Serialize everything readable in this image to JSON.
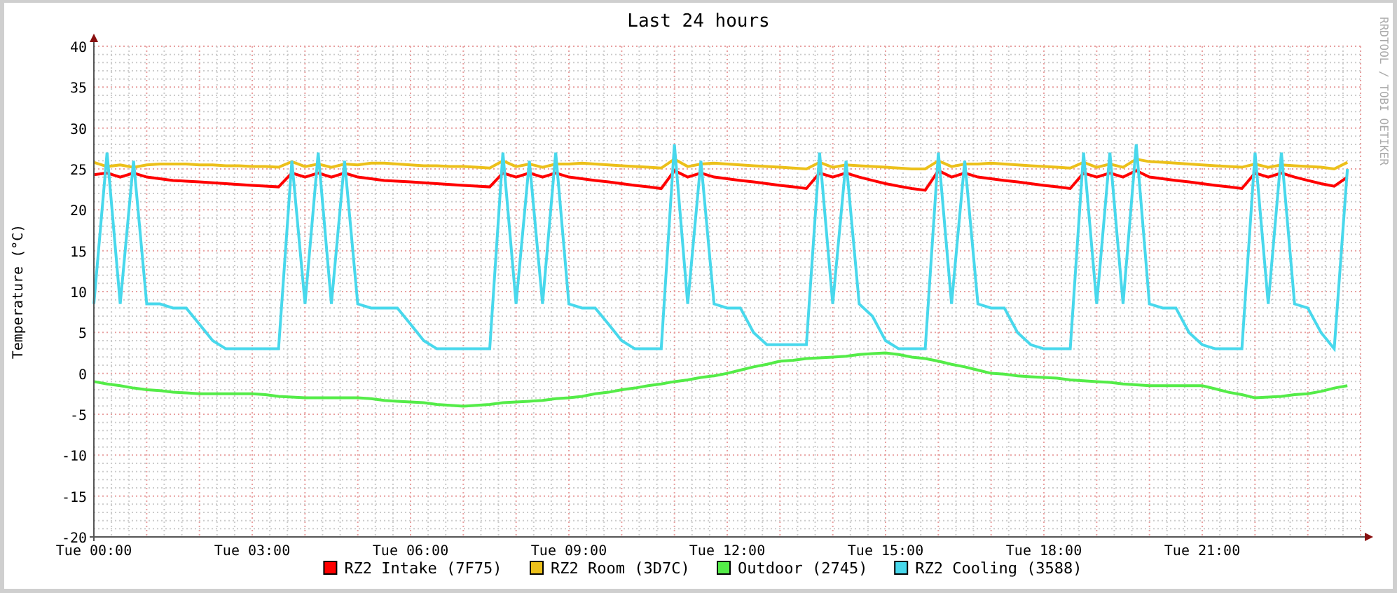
{
  "graph": {
    "side_text": "RRDTOOL / TOBI OETIKER",
    "chart_data": {
      "type": "line",
      "title": "Last 24 hours",
      "ylabel": "Temperature (°C)",
      "categories": [
        "Tue 00:00",
        null,
        null,
        null,
        null,
        null,
        null,
        null,
        null,
        null,
        null,
        null,
        "Tue 03:00",
        null,
        null,
        null,
        null,
        null,
        null,
        null,
        null,
        null,
        null,
        null,
        "Tue 06:00",
        null,
        null,
        null,
        null,
        null,
        null,
        null,
        null,
        null,
        null,
        null,
        "Tue 09:00",
        null,
        null,
        null,
        null,
        null,
        null,
        null,
        null,
        null,
        null,
        null,
        "Tue 12:00",
        null,
        null,
        null,
        null,
        null,
        null,
        null,
        null,
        null,
        null,
        null,
        "Tue 15:00",
        null,
        null,
        null,
        null,
        null,
        null,
        null,
        null,
        null,
        null,
        null,
        "Tue 18:00",
        null,
        null,
        null,
        null,
        null,
        null,
        null,
        null,
        null,
        null,
        null,
        "Tue 21:00",
        null,
        null,
        null,
        null,
        null,
        null,
        null,
        null,
        null,
        null,
        null
      ],
      "ylim": [
        -20,
        40
      ],
      "grid": true,
      "legend": "bottom",
      "yticks": [
        40,
        35,
        30,
        25,
        20,
        15,
        10,
        5,
        0,
        -5,
        -10,
        -15,
        -20
      ],
      "series": [
        {
          "name": "RZ2 Intake (7F75)",
          "color": "#ff0000",
          "values": [
            24.3,
            24.5,
            24,
            24.5,
            24,
            23.8,
            23.6,
            23.5,
            23.4,
            23.3,
            23.2,
            23.1,
            23,
            22.9,
            22.8,
            24.5,
            24,
            24.5,
            24,
            24.5,
            24,
            23.8,
            23.6,
            23.5,
            23.4,
            23.3,
            23.2,
            23.1,
            23,
            22.9,
            22.8,
            24.5,
            24,
            24.5,
            24,
            24.5,
            24,
            23.8,
            23.6,
            23.4,
            23.2,
            23,
            22.8,
            22.6,
            24.8,
            24,
            24.5,
            24,
            23.8,
            23.6,
            23.4,
            23.2,
            23,
            22.8,
            22.6,
            24.5,
            24,
            24.5,
            24,
            23.6,
            23.2,
            22.9,
            22.6,
            22.4,
            24.8,
            24,
            24.5,
            24,
            23.8,
            23.6,
            23.4,
            23.2,
            23,
            22.8,
            22.6,
            24.5,
            24,
            24.5,
            24,
            24.8,
            24,
            23.8,
            23.6,
            23.4,
            23.2,
            23,
            22.8,
            22.6,
            24.5,
            24,
            24.5,
            24,
            23.6,
            23.2,
            22.9,
            24
          ]
        },
        {
          "name": "RZ2 Room (3D7C)",
          "color": "#ecc01a",
          "values": [
            25.8,
            25.3,
            25.5,
            25.2,
            25.5,
            25.6,
            25.6,
            25.6,
            25.5,
            25.5,
            25.4,
            25.4,
            25.3,
            25.3,
            25.2,
            25.9,
            25.3,
            25.6,
            25.2,
            25.6,
            25.5,
            25.7,
            25.7,
            25.6,
            25.5,
            25.4,
            25.4,
            25.3,
            25.3,
            25.2,
            25.1,
            26,
            25.3,
            25.6,
            25.2,
            25.6,
            25.6,
            25.7,
            25.6,
            25.5,
            25.4,
            25.3,
            25.2,
            25.1,
            26.2,
            25.3,
            25.6,
            25.7,
            25.6,
            25.5,
            25.4,
            25.3,
            25.2,
            25.1,
            25,
            25.8,
            25.2,
            25.5,
            25.4,
            25.3,
            25.2,
            25.1,
            25,
            25,
            26,
            25.3,
            25.6,
            25.6,
            25.7,
            25.6,
            25.5,
            25.4,
            25.3,
            25.2,
            25.1,
            25.8,
            25.2,
            25.6,
            25.2,
            26.2,
            25.9,
            25.8,
            25.7,
            25.6,
            25.5,
            25.4,
            25.3,
            25.2,
            25.6,
            25.2,
            25.5,
            25.4,
            25.3,
            25.2,
            25,
            25.8
          ]
        },
        {
          "name": "Outdoor (2745)",
          "color": "#54ec48",
          "values": [
            -1,
            -1.3,
            -1.5,
            -1.8,
            -2,
            -2.1,
            -2.3,
            -2.4,
            -2.5,
            -2.5,
            -2.5,
            -2.5,
            -2.5,
            -2.6,
            -2.8,
            -2.9,
            -3,
            -3,
            -3,
            -3,
            -3,
            -3.1,
            -3.3,
            -3.4,
            -3.5,
            -3.6,
            -3.8,
            -3.9,
            -4,
            -3.9,
            -3.8,
            -3.6,
            -3.5,
            -3.4,
            -3.3,
            -3.1,
            -3,
            -2.8,
            -2.5,
            -2.3,
            -2,
            -1.8,
            -1.5,
            -1.3,
            -1,
            -0.8,
            -0.5,
            -0.3,
            0,
            0.4,
            0.8,
            1.1,
            1.5,
            1.6,
            1.8,
            1.9,
            2,
            2.1,
            2.3,
            2.4,
            2.5,
            2.3,
            2,
            1.8,
            1.5,
            1.1,
            0.8,
            0.4,
            0,
            -0.1,
            -0.3,
            -0.4,
            -0.5,
            -0.6,
            -0.8,
            -0.9,
            -1,
            -1.1,
            -1.3,
            -1.4,
            -1.5,
            -1.5,
            -1.5,
            -1.5,
            -1.5,
            -1.9,
            -2.3,
            -2.6,
            -3,
            -2.9,
            -2.8,
            -2.6,
            -2.5,
            -2.2,
            -1.8,
            -1.5
          ]
        },
        {
          "name": "RZ2 Cooling (3588)",
          "color": "#48d8ec",
          "values": [
            8.5,
            27,
            8.5,
            26,
            8.5,
            8.5,
            8,
            8,
            6,
            4,
            3,
            3,
            3,
            3,
            3,
            26,
            8.5,
            27,
            8.5,
            26,
            8.5,
            8,
            8,
            8,
            6,
            4,
            3,
            3,
            3,
            3,
            3,
            27,
            8.5,
            26,
            8.5,
            27,
            8.5,
            8,
            8,
            6,
            4,
            3,
            3,
            3,
            28,
            8.5,
            26,
            8.5,
            8,
            8,
            5,
            3.5,
            3.5,
            3.5,
            3.5,
            27,
            8.5,
            26,
            8.5,
            7,
            4,
            3,
            3,
            3,
            27,
            8.5,
            26,
            8.5,
            8,
            8,
            5,
            3.5,
            3,
            3,
            3,
            27,
            8.5,
            27,
            8.5,
            28,
            8.5,
            8,
            8,
            5,
            3.5,
            3,
            3,
            3,
            27,
            8.5,
            27,
            8.5,
            8,
            5,
            3,
            25
          ]
        }
      ]
    }
  }
}
